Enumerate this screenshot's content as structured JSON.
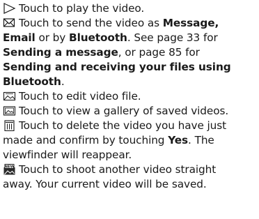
{
  "items": [
    {
      "icon": "play-icon",
      "text": "Touch to play the video."
    },
    {
      "icon": "envelope-icon",
      "line1_pre": "Touch to send the video as ",
      "line1_bold": "Message,",
      "line2_bold1": "Email",
      "line2_mid": " or by ",
      "line2_bold2": "Bluetooth",
      "line2_post": ". See page 33 for",
      "line3_bold": "Sending a message",
      "line3_post": ", or page 85 for",
      "line4_bold": "Sending and receiving your files using",
      "line5_bold": "Bluetooth",
      "line5_post": "."
    },
    {
      "icon": "edit-video-icon",
      "text": "Touch to edit video file."
    },
    {
      "icon": "gallery-icon",
      "text": "Touch to view a gallery of saved videos."
    },
    {
      "icon": "trash-icon",
      "line1": "Touch to delete the video you have just",
      "line2_pre": "made and confirm by touching ",
      "line2_bold": "Yes",
      "line2_post": ". The",
      "line3": "viewfinder will reappear."
    },
    {
      "icon": "new-video-icon",
      "icon_text": "NEW",
      "line1": "Touch to shoot another video straight",
      "line2": "away. Your current video will be saved."
    }
  ]
}
